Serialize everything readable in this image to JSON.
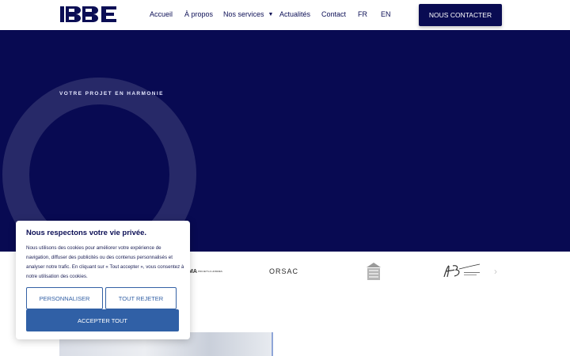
{
  "header": {
    "logo_alt": "BBE",
    "nav": [
      {
        "label": "Accueil"
      },
      {
        "label": "À propos"
      },
      {
        "label": "Nos services"
      },
      {
        "label": "Actualités"
      },
      {
        "label": "Contact"
      },
      {
        "label": "FR"
      },
      {
        "label": "EN"
      }
    ],
    "cta_label": "NOUS CONTACTER"
  },
  "hero": {
    "tagline": "VOTRE PROJET EN HARMONIE"
  },
  "partners": {
    "ma_label": "MA",
    "ma_sub": "PROJETS & HOMMES",
    "orsac_label": "ORSAC",
    "house_icon": "building-icon",
    "hb_icon": "hb-signature-logo"
  },
  "cookie": {
    "title": "Nous respectons votre vie privée.",
    "text": "Nous utilisons des cookies pour améliorer votre expérience de navigation, diffuser des publicités ou des contenus personnalisés et analyser notre trafic. En cliquant sur « Tout accepter », vous consentez à notre utilisation des cookies.",
    "customize_label": "PERSONNALISER",
    "reject_label": "TOUT REJETER",
    "accept_label": "ACCEPTER TOUT"
  },
  "colors": {
    "navy": "#080a52",
    "button_blue": "#3060a6"
  }
}
